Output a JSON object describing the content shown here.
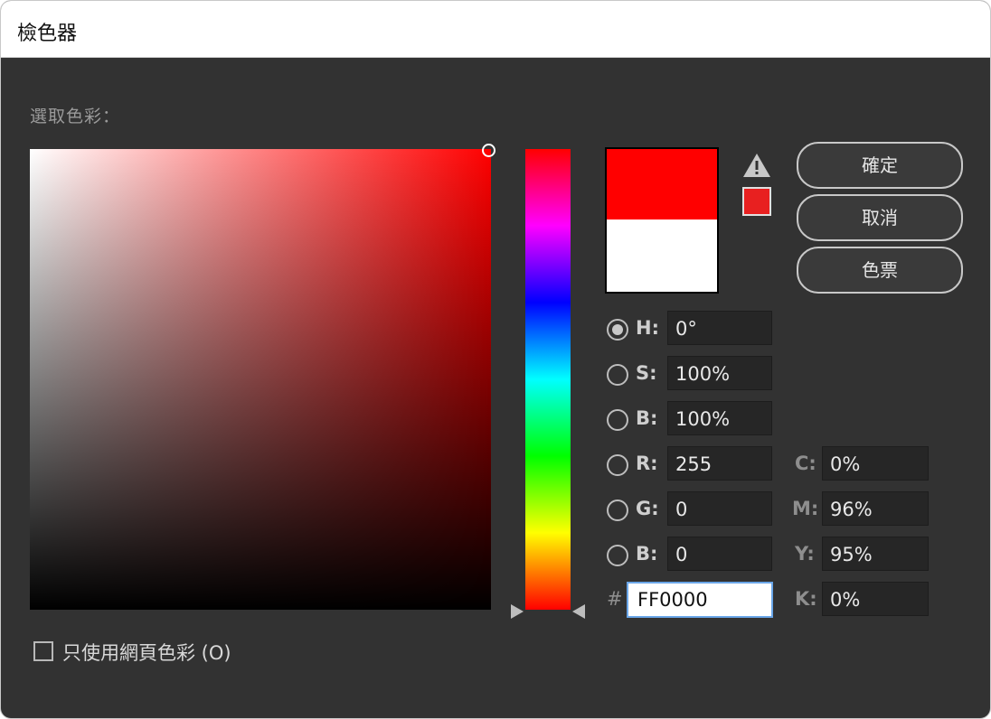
{
  "window": {
    "title": "檢色器"
  },
  "picker": {
    "label": "選取色彩："
  },
  "colors": {
    "new": "#ff0000",
    "old": "#ffffff",
    "gamut": "#e82020"
  },
  "buttons": {
    "ok": "確定",
    "cancel": "取消",
    "swatches": "色票"
  },
  "hsb": {
    "h_label": "H:",
    "h_value": "0°",
    "s_label": "S:",
    "s_value": "100%",
    "b_label": "B:",
    "b_value": "100%",
    "selected": "H"
  },
  "rgb": {
    "r_label": "R:",
    "r_value": "255",
    "g_label": "G:",
    "g_value": "0",
    "b_label": "B:",
    "b_value": "0"
  },
  "cmyk": {
    "c_label": "C:",
    "c_value": "0%",
    "m_label": "M:",
    "m_value": "96%",
    "y_label": "Y:",
    "y_value": "95%",
    "k_label": "K:",
    "k_value": "0%"
  },
  "hex": {
    "label": "#",
    "value": "FF0000"
  },
  "web_only": {
    "label": "只使用網頁色彩 (O)",
    "checked": false
  },
  "icons": {
    "warning": "warning-triangle-icon"
  }
}
